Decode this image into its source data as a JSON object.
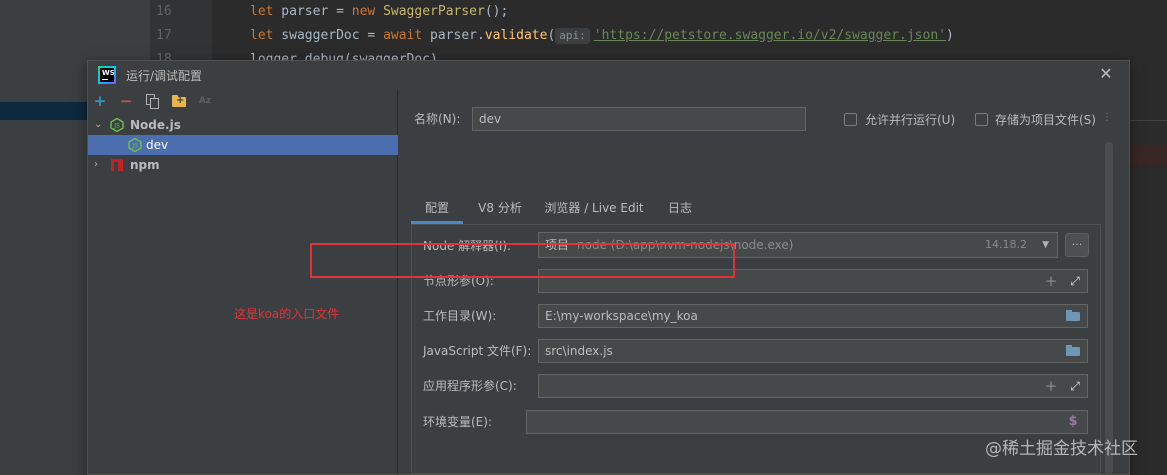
{
  "editor": {
    "lines": [
      {
        "num": "16",
        "kw": "let",
        "var": " parser = ",
        "kw2": "new",
        "cls": " SwaggerParser",
        "rest": "();"
      },
      {
        "num": "17",
        "kw": "let",
        "var": " swaggerDoc = ",
        "kw2": "await",
        "obj": " parser.",
        "fn": "validate",
        "open": "(",
        "hint": "api:",
        "str": "'https://petstore.swagger.io/v2/swagger.json'",
        "close": ")"
      },
      {
        "num": "18",
        "text": "logger.debug(swaggerDoc)"
      }
    ]
  },
  "dialog": {
    "title": "运行/调试配置",
    "close_icon": "close-icon",
    "toolbar": {
      "add": "+",
      "remove": "−",
      "sort": "Az"
    },
    "tree": [
      {
        "label": "Node.js",
        "icon": "nodejs-icon",
        "expanded": true
      },
      {
        "label": "dev",
        "icon": "nodejs-icon",
        "selected": true
      },
      {
        "label": "npm",
        "icon": "npm-icon",
        "expanded": false
      }
    ]
  },
  "config": {
    "name_label": "名称(N):",
    "name_value": "dev",
    "parallel_label": "允许并行运行(U)",
    "store_label": "存储为项目文件(S)",
    "tabs": [
      "配置",
      "V8 分析",
      "浏览器 / Live Edit",
      "日志"
    ],
    "active_tab": "配置",
    "fields": {
      "interpreter_label": "Node 解释器(I):",
      "interpreter_main": "项目",
      "interpreter_path": "node (D:\\app\\nvm-nodejs\\node.exe)",
      "interpreter_version": "14.18.2",
      "browse_label": "...",
      "node_params_label": "节点形参(O):",
      "node_params_value": "",
      "workdir_label": "工作目录(W):",
      "workdir_value": "E:\\my-workspace\\my_koa",
      "js_file_label": "JavaScript 文件(F):",
      "js_file_value": "src\\index.js",
      "app_params_label": "应用程序形参(C):",
      "app_params_value": "",
      "env_label": "环境变量(E):",
      "env_value": ""
    }
  },
  "annotation": "这是koa的入口文件",
  "watermark": "@稀土掘金技术社区",
  "colors": {
    "accent": "#4a88c7",
    "selection": "#4b6eaf",
    "annotation_red": "#e0343a"
  }
}
